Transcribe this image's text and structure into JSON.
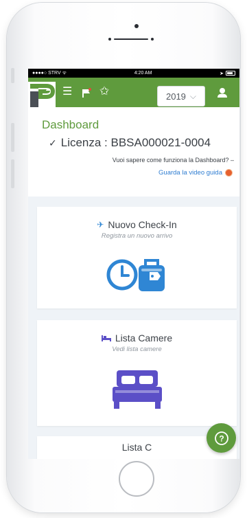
{
  "status_bar": {
    "carrier": "●●●●○ STRV",
    "wifi": "ᯤ",
    "time": "4:20 AM",
    "location": "➤"
  },
  "header": {
    "menu_icon": "menu-icon",
    "flag_icon": "flag-icon",
    "star_icon": "star-icon",
    "year": "2019",
    "year_chevron": "⌵",
    "user_icon": "user-icon",
    "brand_color": "#5f9b3d"
  },
  "dashboard": {
    "title": "Dashboard",
    "check_mark": "✓",
    "license": "Licenza : BBSA000021-0004",
    "help_question": "Vuoi sapere come funziona la Dashboard? –",
    "video_link": "Guarda la video guida"
  },
  "cards": {
    "checkin": {
      "icon": "✈",
      "title": "Nuovo Check-In",
      "subtitle": "Registra un nuovo arrivo",
      "color": "#2f86d4"
    },
    "rooms": {
      "icon": "🛏",
      "title": "Lista Camere",
      "subtitle": "Vedi lista camere",
      "color": "#5b4fc7"
    },
    "third": {
      "title": "Lista C"
    }
  },
  "fab": {
    "icon": "?",
    "color": "#5f9b3d"
  }
}
